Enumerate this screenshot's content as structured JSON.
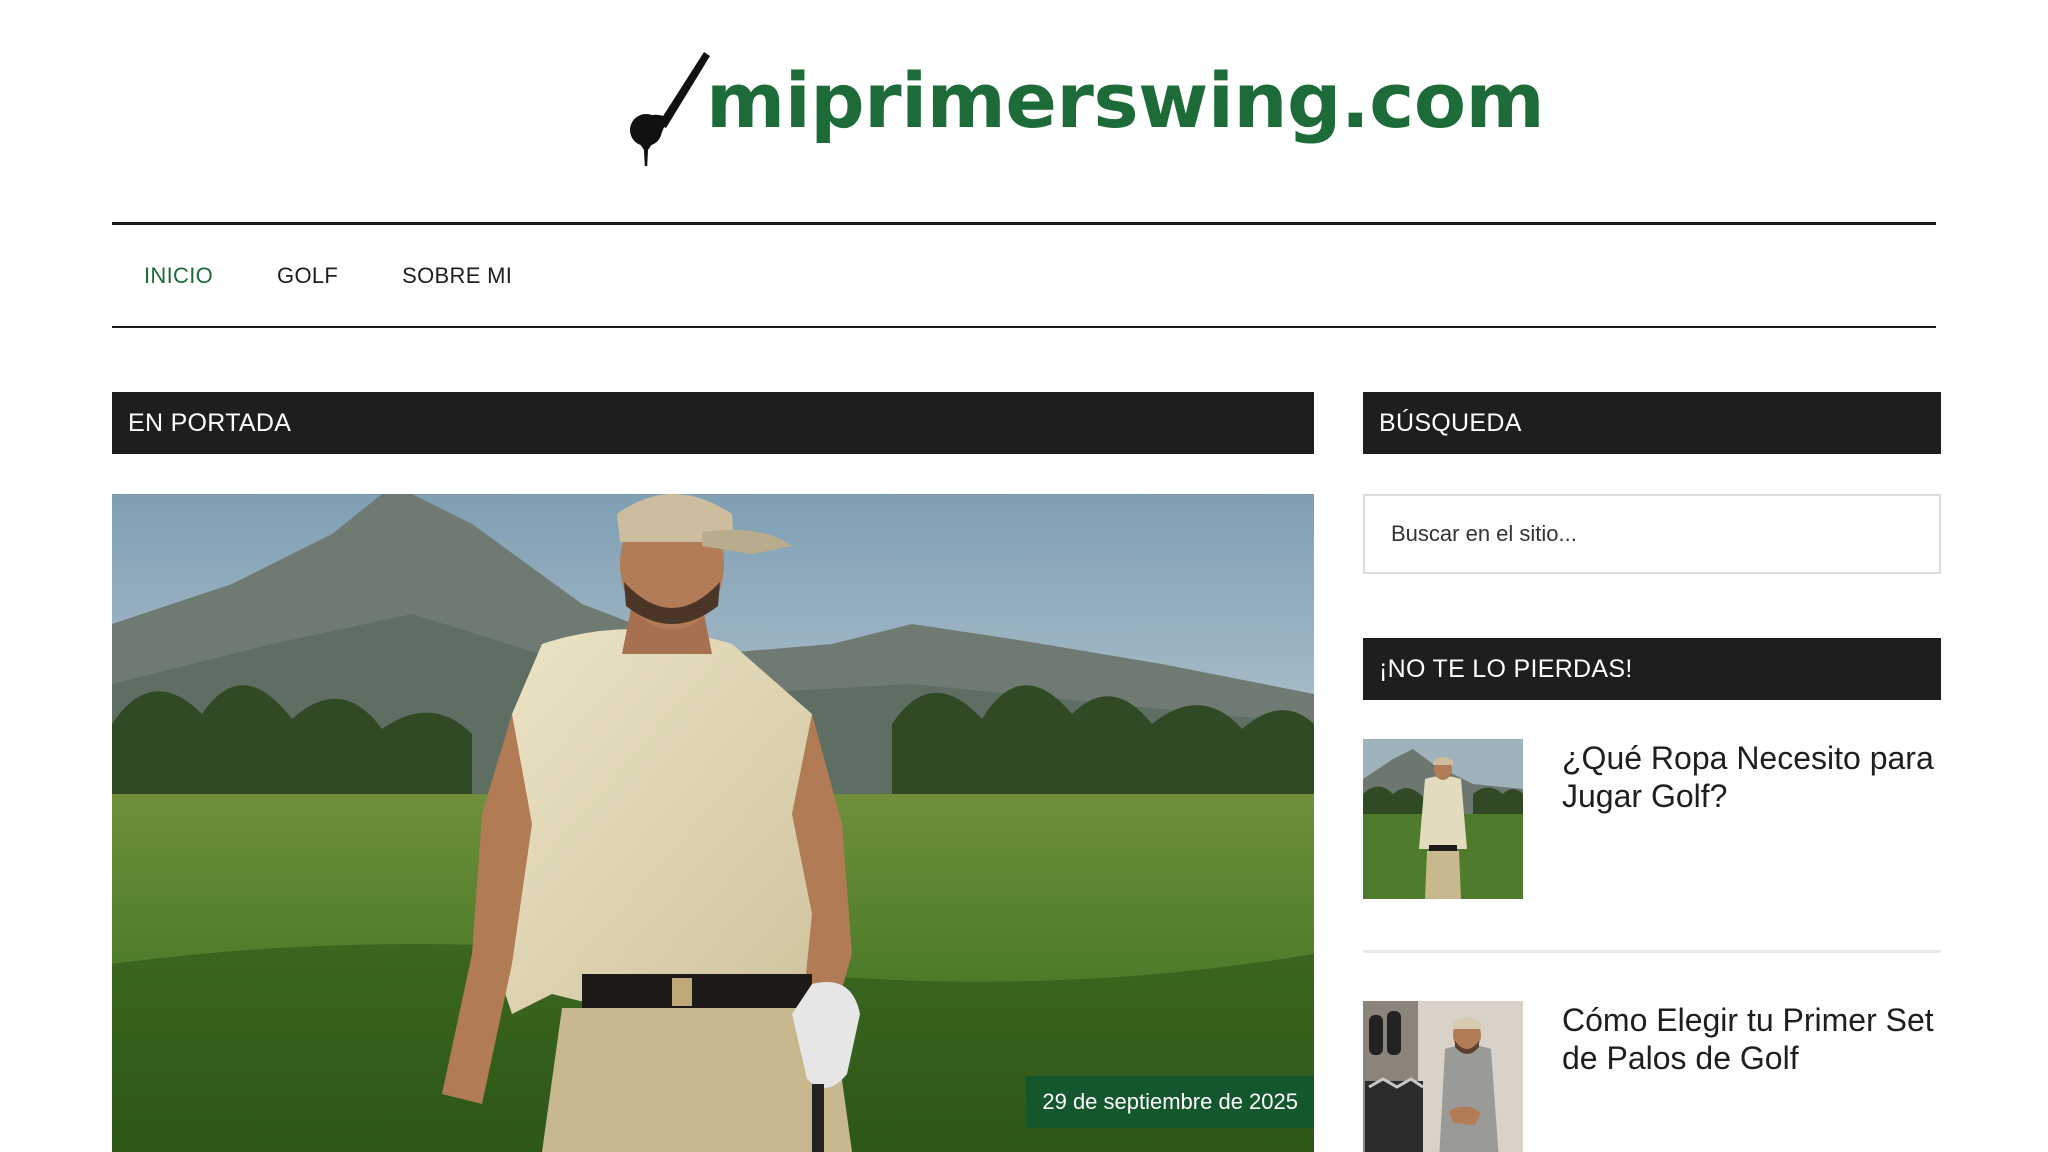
{
  "site": {
    "logo_text": "miprimerswing.com",
    "brand_color": "#1c6b38"
  },
  "nav": {
    "items": [
      {
        "label": "INICIO",
        "active": true
      },
      {
        "label": "GOLF",
        "active": false
      },
      {
        "label": "SOBRE MI",
        "active": false
      }
    ]
  },
  "main": {
    "section_title": "EN PORTADA",
    "featured": {
      "date": "29 de septiembre de 2025",
      "image_icon": "golfer-on-course-photo"
    }
  },
  "sidebar": {
    "search_title": "BÚSQUEDA",
    "search_placeholder": "Buscar en el sitio...",
    "posts_title": "¡NO TE LO PIERDAS!",
    "posts": [
      {
        "title": "¿Qué Ropa Necesito para Jugar Golf?",
        "thumb_icon": "golfer-thumbnail"
      },
      {
        "title": "Cómo Elegir tu Primer Set de Palos de Golf",
        "thumb_icon": "golf-clubs-shop-thumbnail"
      }
    ]
  },
  "colors": {
    "heading_bg": "#1e1e1e",
    "date_badge_bg": "#15572c",
    "nav_active": "#1c6b38"
  }
}
